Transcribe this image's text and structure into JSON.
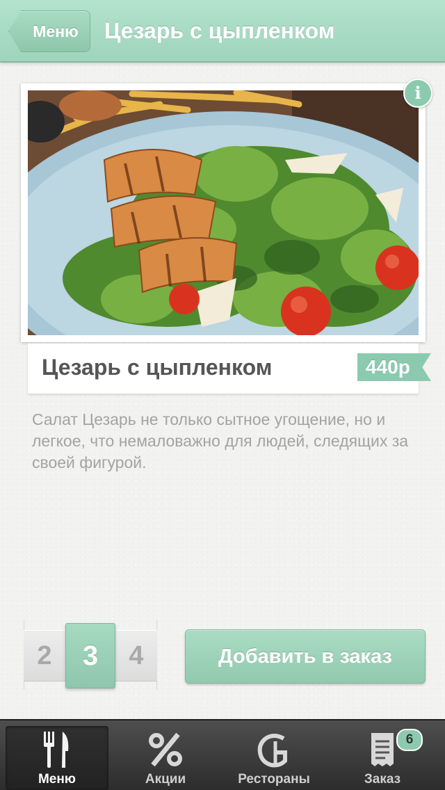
{
  "navbar": {
    "back_label": "Меню",
    "title": "Цезарь с цыпленком"
  },
  "dish": {
    "info_icon": "info-icon",
    "name": "Цезарь с цыпленком",
    "price": "440р",
    "description": "Салат Цезарь не только сытное угощение, но и легкое, что немаловажно для людей, следящих за своей фигурой."
  },
  "quantity": {
    "prev": "2",
    "selected": "3",
    "next": "4"
  },
  "add_button_label": "Добавить в заказ",
  "tabs": [
    {
      "label": "Меню",
      "icon": "fork-knife-icon",
      "active": true
    },
    {
      "label": "Акции",
      "icon": "percent-icon",
      "active": false
    },
    {
      "label": "Рестораны",
      "icon": "restaurant-logo-icon",
      "active": false
    },
    {
      "label": "Заказ",
      "icon": "receipt-icon",
      "active": false,
      "badge": "6"
    }
  ],
  "colors": {
    "accent": "#9fd4bc",
    "tabbar": "#3a3a3a",
    "description_text": "#a3a3a3"
  }
}
